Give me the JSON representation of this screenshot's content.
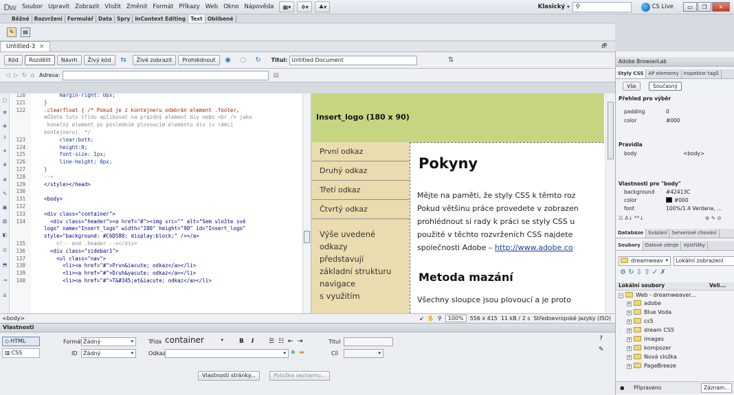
{
  "app": {
    "logo": "Dw",
    "workspace": "Klasický",
    "cslive": "CS Live"
  },
  "menu": [
    "Soubor",
    "Upravit",
    "Zobrazit",
    "Vložit",
    "Změnit",
    "Formát",
    "Příkazy",
    "Web",
    "Okno",
    "Nápověda"
  ],
  "insert_tabs": [
    "Běžné",
    "Rozvržení",
    "Formulář",
    "Data",
    "Spry",
    "InContext Editing",
    "Text",
    "Oblíbené"
  ],
  "document": {
    "tab": "Untitled-3",
    "views": [
      "Kód",
      "Rozdělit",
      "Návrh",
      "Živý kód",
      "Živé zobrazit",
      "Prohlédnout"
    ],
    "title_label": "Titul:",
    "title_value": "Untitled Document",
    "address_label": "Adresa:"
  },
  "code": {
    "lines": [
      {
        "n": "120",
        "t": "     margin-right: 0px;",
        "c": "prop"
      },
      {
        "n": "121",
        "t": "}",
        "c": "sel"
      },
      {
        "n": "122",
        "t": ".clearfloat { /* Pokud je z kontejneru odebrán element .footer,",
        "c": "sel"
      },
      {
        "n": "",
        "t": "můžete tuto třídu aplikovat na prázdný element div nebo <br /> jako",
        "c": "cmt"
      },
      {
        "n": "",
        "t": " konečný element po posledním plovoucím elementu div (v rámci",
        "c": "cmt"
      },
      {
        "n": "",
        "t": "kontejneru). */",
        "c": "cmt"
      },
      {
        "n": "123",
        "t": "     clear:both;",
        "c": "prop"
      },
      {
        "n": "124",
        "t": "     height:0;",
        "c": "prop"
      },
      {
        "n": "125",
        "t": "     font-size: 1px;",
        "c": "prop"
      },
      {
        "n": "126",
        "t": "     line-height: 0px;",
        "c": "prop"
      },
      {
        "n": "127",
        "t": "}",
        "c": "sel"
      },
      {
        "n": "128",
        "t": "-->",
        "c": "cmt"
      },
      {
        "n": "129",
        "t": "</style></head>",
        "c": "tag"
      },
      {
        "n": "130",
        "t": "",
        "c": "tag"
      },
      {
        "n": "131",
        "t": "<body>",
        "c": "tag"
      },
      {
        "n": "132",
        "t": "",
        "c": "tag"
      },
      {
        "n": "133",
        "t": "<div class=\"container\">",
        "c": "tag"
      },
      {
        "n": "134",
        "t": "  <div class=\"header\"><a href=\"#\"><img src=\"\" alt=\"Sem vložte své",
        "c": "tag"
      },
      {
        "n": "",
        "t": "logo\" name=\"Insert_logo\" width=\"180\" height=\"90\" id=\"Insert_logo\"",
        "c": "tag"
      },
      {
        "n": "",
        "t": "style=\"background: #C6D580; display:block;\" /></a>",
        "c": "tag"
      },
      {
        "n": "135",
        "t": "    <!-- end .header --></div>",
        "c": "cmt"
      },
      {
        "n": "136",
        "t": "  <div class=\"sidebar1\">",
        "c": "tag"
      },
      {
        "n": "137",
        "t": "    <ul class=\"nav\">",
        "c": "tag"
      },
      {
        "n": "138",
        "t": "      <li><a href=\"#\">Prvn&iacute; odkaz</a></li>",
        "c": "tag"
      },
      {
        "n": "139",
        "t": "      <li><a href=\"#\">Druh&yacute; odkaz</a></li>",
        "c": "tag"
      },
      {
        "n": "140",
        "t": "      <li><a href=\"#\">T&#345;et&iacute; odkaz</a></li>",
        "c": "tag"
      }
    ]
  },
  "design": {
    "logo_placeholder": "Insert_logo (180 x 90)",
    "nav": [
      "První odkaz",
      "Druhý odkaz",
      "Třetí odkaz",
      "Čtvrtý odkaz"
    ],
    "sidebar_text": [
      "Výše uvedené",
      "odkazy",
      "představují",
      "základní strukturu",
      "navigace",
      "s využitím"
    ],
    "heading": "Pokyny",
    "para_lines": [
      "Mějte na paměti, že styly CSS k těmto roz",
      "Pokud většinu práce provedete v zobrazen",
      "prohlédnout si rady k práci se styly CSS u",
      "použité v těchto rozvrženích CSS najdete",
      "společnosti Adobe – "
    ],
    "link": "http://www.adobe.co",
    "heading2": "Metoda mazání",
    "para2": "Všechny sloupce jsou plovoucí a je proto"
  },
  "status": {
    "tag": "<body>",
    "zoom": "100%",
    "dims": "556 x 415",
    "size": "11 kB / 2 s",
    "encoding": "Středoevropské jazyky (ISO)"
  },
  "properties": {
    "panel": "Vlastnosti",
    "html": "HTML",
    "css": "CSS",
    "format_label": "Formát",
    "format_value": "Žádný",
    "id_label": "ID",
    "id_value": "Žádný",
    "class_label": "Třída",
    "class_value": "container",
    "link_label": "Odkaz",
    "title_label": "Titul",
    "target_label": "Cíl",
    "page_props": "Vlastnosti stránky...",
    "list_item": "Položka seznamu..."
  },
  "right": {
    "browserlab": "Adobe BrowserLab",
    "css_tabs": [
      "Styly CSS",
      "AP elementy",
      "Inspektor tagů"
    ],
    "css_modes": [
      "Vše",
      "Současný"
    ],
    "summary_title": "Přehled pro výběr",
    "summary": [
      {
        "k": "padding",
        "v": "0"
      },
      {
        "k": "color",
        "v": "#000"
      }
    ],
    "rules_title": "Pravidla",
    "rules": [
      {
        "k": "body",
        "v": "<body>"
      }
    ],
    "props_title": "Vlastnosti pro \"body\"",
    "props": [
      {
        "k": "background",
        "v": "#42413C"
      },
      {
        "k": "color",
        "v": "#000"
      },
      {
        "k": "font",
        "v": "100%/1.4 Verdana, ..."
      }
    ],
    "db_tabs": [
      "Databáze",
      "Svázání",
      "Serverové chování"
    ],
    "file_tabs": [
      "Soubory",
      "Datové zdroje",
      "Výstřižky"
    ],
    "site": "dreamweav",
    "view": "Lokální zobrazení",
    "col_local": "Lokální soubory",
    "col_size": "Veli...",
    "root": "Web - dreamweaver...",
    "folders": [
      "adobe",
      "Blue Voda",
      "cs5",
      "dream CS5",
      "images",
      "kompozer",
      "Nová složka",
      "PageBreeze"
    ],
    "status": "Připraveno",
    "log": "Záznam..."
  },
  "colors": {
    "header": "#C6D580",
    "sidebar": "#EADCAE",
    "body_bg": "#42413C"
  }
}
